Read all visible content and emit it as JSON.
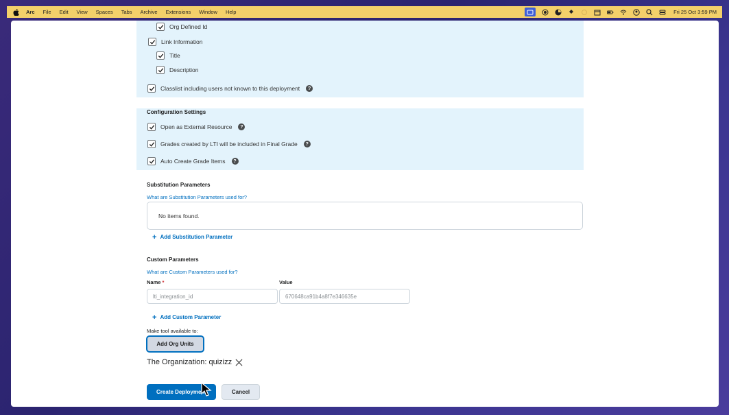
{
  "menubar": {
    "app": "Arc",
    "items": [
      "File",
      "Edit",
      "View",
      "Spaces",
      "Tabs",
      "Archive",
      "Extensions",
      "Window",
      "Help"
    ],
    "clock": "Fri 25 Oct  3:59 PM"
  },
  "security": {
    "org_defined_id": "Org Defined Id",
    "link_information": "Link Information",
    "title": "Title",
    "description": "Description",
    "classlist": "Classlist including users not known to this deployment"
  },
  "config": {
    "heading": "Configuration Settings",
    "open_external": "Open as External Resource",
    "grades_final": "Grades created by LTI will be included in Final Grade",
    "auto_grade": "Auto Create Grade Items"
  },
  "substitution": {
    "heading": "Substitution Parameters",
    "help_link": "What are Substitution Parameters used for?",
    "empty": "No items found.",
    "add": "Add Substitution Parameter"
  },
  "custom": {
    "heading": "Custom Parameters",
    "help_link": "What are Custom Parameters used for?",
    "name_label": "Name",
    "required_mark": "*",
    "value_label": "Value",
    "name_value": "lti_integration_id",
    "value_value": "670648ca91b4a8f7e346635e",
    "add": "Add Custom Parameter"
  },
  "availability": {
    "label": "Make tool available to:",
    "add_org_units": "Add Org Units",
    "org": "The Organization: quizizz"
  },
  "actions": {
    "create": "Create Deployment",
    "cancel": "Cancel"
  },
  "colors": {
    "menubar": "#f3d06a",
    "panel": "#e3f3fc",
    "primary": "#006fbf",
    "link": "#006fbf"
  }
}
